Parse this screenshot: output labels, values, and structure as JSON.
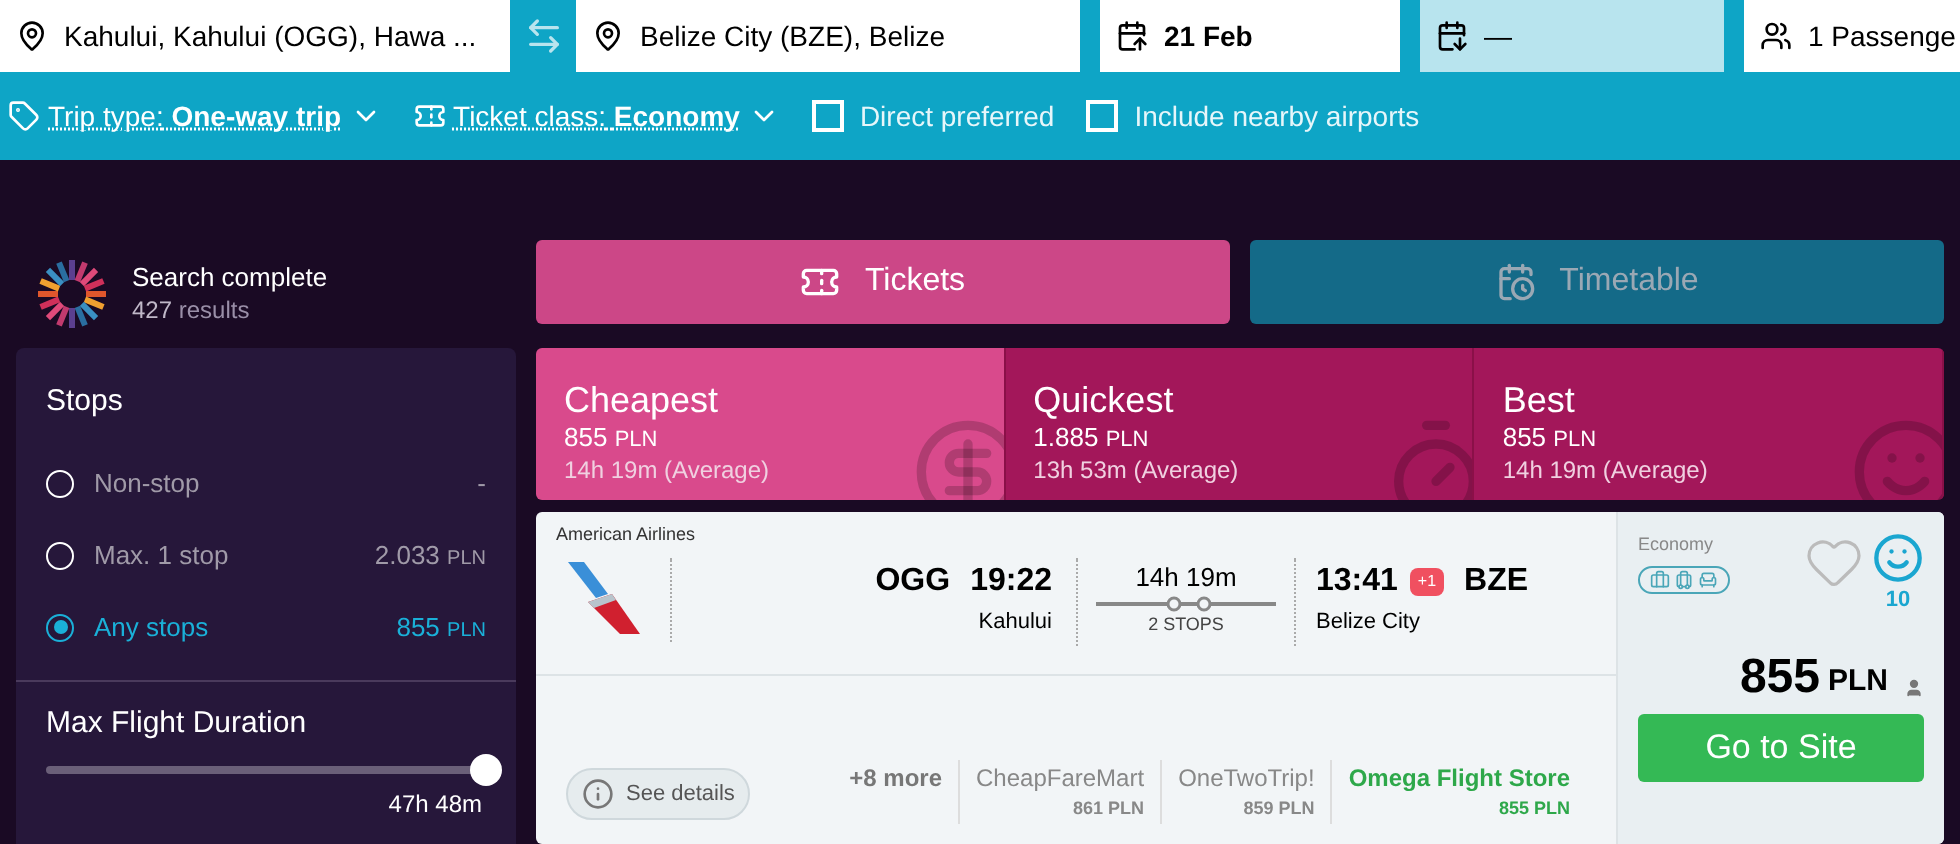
{
  "search": {
    "origin": "Kahului, Kahului (OGG), Hawa ...",
    "destination": "Belize City (BZE), Belize",
    "depart": "21 Feb",
    "return": "—",
    "passengers": "1 Passenge"
  },
  "options": {
    "trip_type_label": "Trip type:",
    "trip_type": "One-way trip",
    "ticket_class_label": "Ticket class:",
    "ticket_class": "Economy",
    "checkboxes": [
      {
        "label": "Direct preferred",
        "checked": false
      },
      {
        "label": "Include nearby airports",
        "checked": false
      }
    ]
  },
  "status": {
    "title": "Search complete",
    "count": "427",
    "count_label": "results"
  },
  "filters": {
    "stops_title": "Stops",
    "stops": [
      {
        "label": "Non-stop",
        "price": "-",
        "selected": false
      },
      {
        "label": "Max. 1 stop",
        "price": "2.033",
        "currency": "PLN",
        "selected": false
      },
      {
        "label": "Any stops",
        "price": "855",
        "currency": "PLN",
        "selected": true
      }
    ],
    "duration_title": "Max Flight Duration",
    "duration": {
      "level": 1,
      "reading": "47h 48m"
    }
  },
  "view_tabs": [
    {
      "label": "Tickets",
      "kind": "ticket",
      "selected": true
    },
    {
      "label": "Timetable",
      "kind": "calendar",
      "selected": false
    }
  ],
  "sort_tabs": [
    {
      "label": "Cheapest",
      "price": "855",
      "currency": "PLN",
      "duration": "14h 19m (Average)",
      "kind": "dollar",
      "selected": true
    },
    {
      "label": "Quickest",
      "price": "1.885",
      "currency": "PLN",
      "duration": "13h 53m (Average)",
      "kind": "stopwatch",
      "selected": false
    },
    {
      "label": "Best",
      "price": "855",
      "currency": "PLN",
      "duration": "14h 19m (Average)",
      "kind": "smile",
      "selected": false
    }
  ],
  "result": {
    "airline": "American Airlines",
    "from_code": "OGG",
    "depart_time": "19:22",
    "from_city": "Kahului",
    "duration": "14h 19m",
    "stops": "2 STOPS",
    "arrive_time": "13:41",
    "day_offset": "+1",
    "to_code": "BZE",
    "to_city": "Belize City",
    "details": "See details",
    "more": "+8 more",
    "providers": [
      {
        "name": "CheapFareMart",
        "price": "861 PLN",
        "selected": false
      },
      {
        "name": "OneTwoTrip!",
        "price": "859 PLN",
        "selected": false
      },
      {
        "name": "Omega Flight Store",
        "price": "855 PLN",
        "selected": true
      }
    ],
    "cabin": "Economy",
    "score": "10",
    "price": "855",
    "currency": "PLN",
    "cta": "Go to Site"
  }
}
